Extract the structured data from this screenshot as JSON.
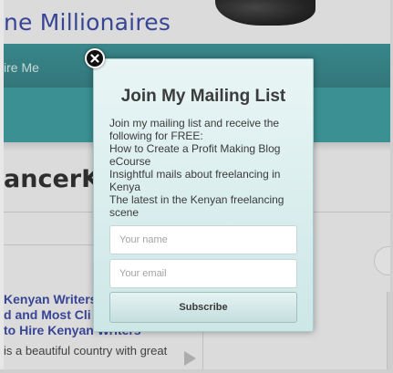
{
  "site": {
    "title": "ne Millionaires",
    "nav_item": "ire Me",
    "page_heading": "ancerKe"
  },
  "post": {
    "title_lines": [
      "Kenyan Writers",
      "d and Most Cli",
      "to Hire Kenyan Writers"
    ],
    "excerpt": "is a beautiful country with great"
  },
  "popup": {
    "title": "Join My Mailing List",
    "body_lines": [
      "Join my mailing list and receive the",
      "following for FREE:",
      "How to Create a Profit Making Blog",
      "eCourse",
      "Insightful mails about freelancing in",
      "Kenya",
      "The latest in the Kenyan freelancing",
      "scene"
    ],
    "name_placeholder": "Your name",
    "email_placeholder": "Your email",
    "subscribe_label": "Subscribe"
  },
  "icons": {
    "close": "close-icon",
    "play": "play-icon"
  },
  "colors": {
    "title_blue": "#2a3a9a",
    "nav_teal": "#2a8a8f",
    "popup_bg": "#d9eeee"
  }
}
